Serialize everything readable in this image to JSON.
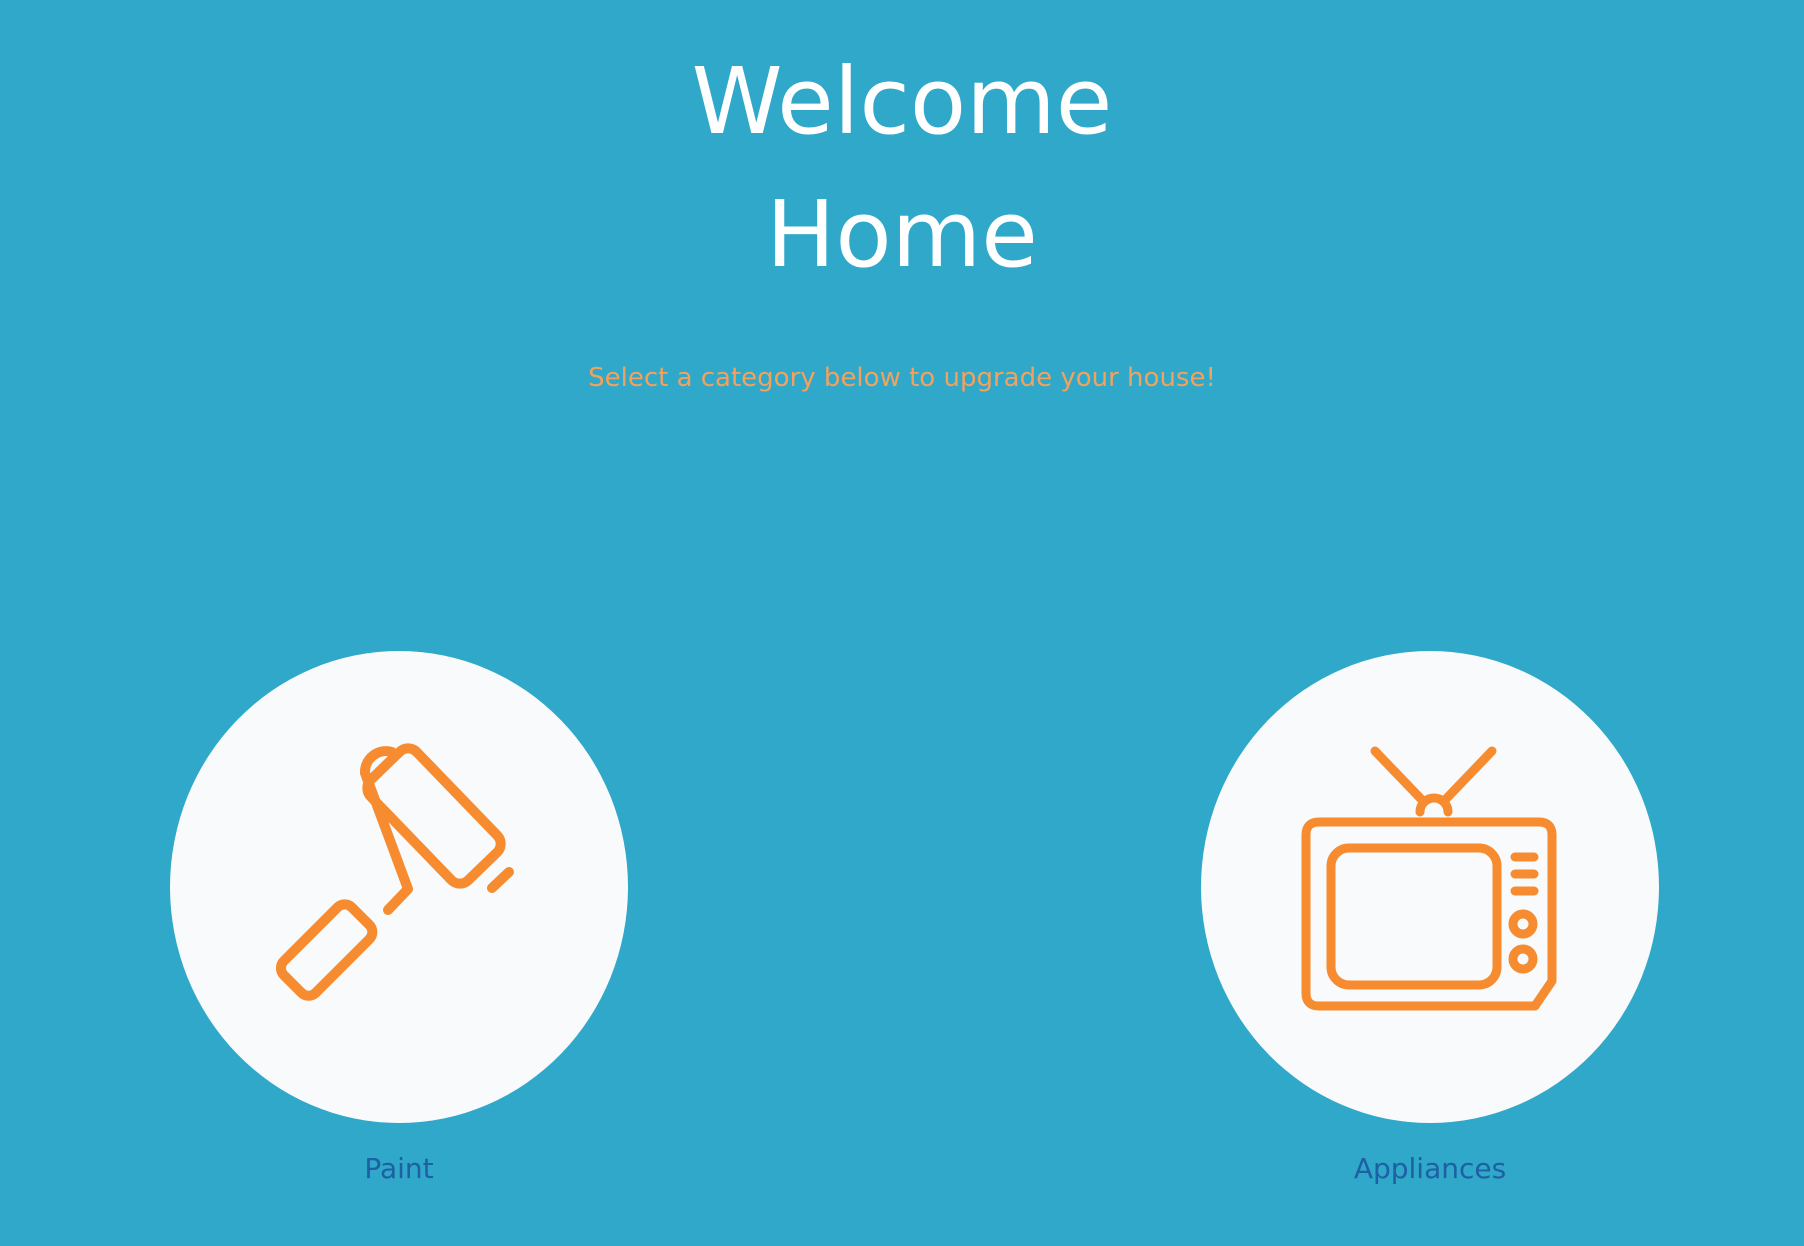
{
  "header": {
    "title_line_1": "Welcome",
    "title_line_2": "Home",
    "subtitle": "Select a category below to upgrade your house!"
  },
  "categories": [
    {
      "label": "Paint",
      "icon": "paint-roller-icon"
    },
    {
      "label": "Appliances",
      "icon": "television-icon"
    }
  ],
  "colors": {
    "background": "#2fa8c9",
    "title": "#ffffff",
    "subtitle": "#f2a25c",
    "icon": "#f68b30",
    "circle": "#f8fafb",
    "label": "#1f5fa3"
  }
}
